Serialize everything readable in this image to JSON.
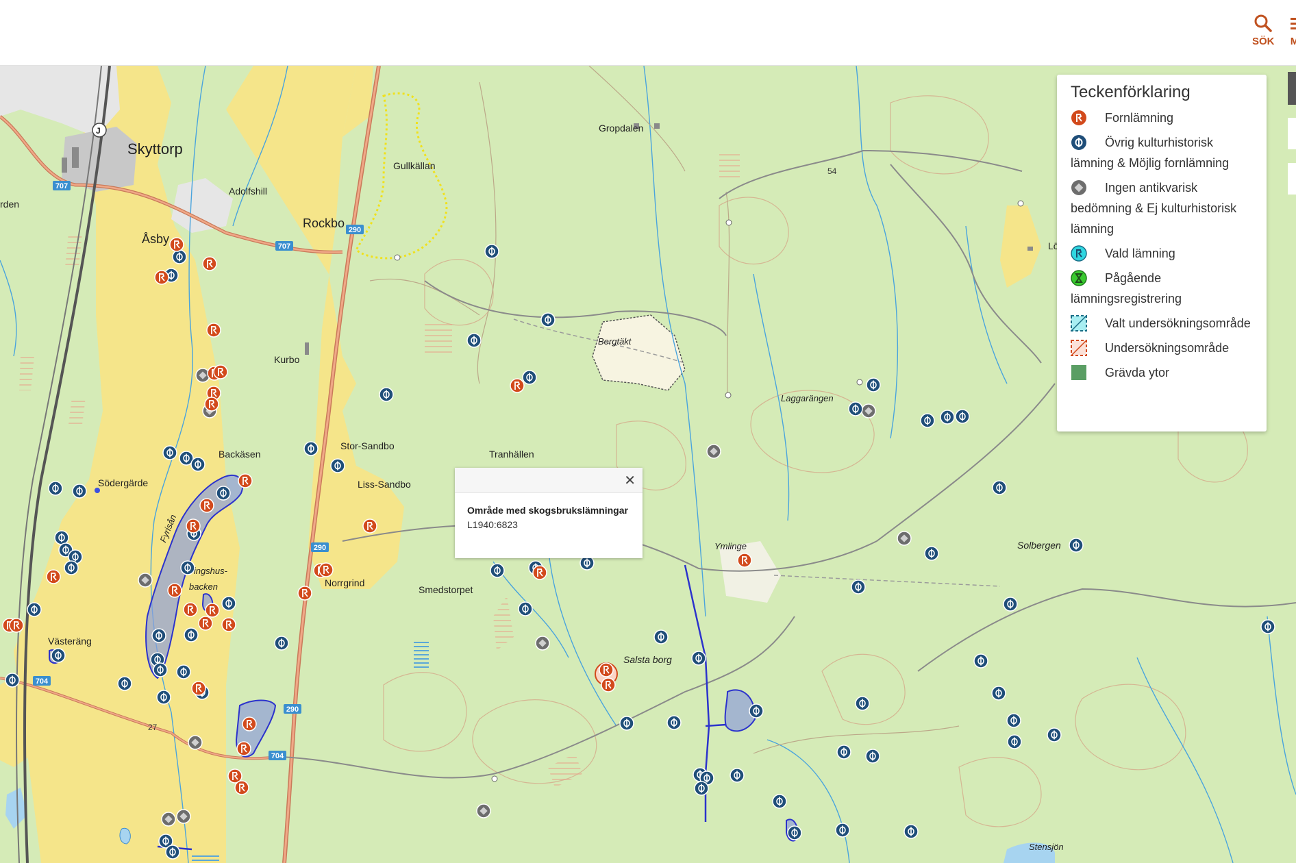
{
  "toolbar": {
    "search_label": "SÖK",
    "menu_label": "M"
  },
  "colors": {
    "accent": "#c0511f",
    "forn": "#d24a1c",
    "ovrig": "#1f4e79",
    "ingen": "#6d6d6d",
    "vald": "#2fd6e0",
    "pagaende": "#39c92f",
    "gravda": "#5a9e64",
    "field": "#f5e58a",
    "forest": "#d5ebb7"
  },
  "legend": {
    "title": "Teckenförklaring",
    "items": [
      {
        "label": "Fornlämning",
        "icon": "fornlamning-icon"
      },
      {
        "label": "Övrig kulturhistorisk lämning & Möjlig fornlämning",
        "icon": "ovrig-lamning-icon"
      },
      {
        "label": "Ingen antikvarisk bedömning & Ej kulturhistorisk lämning",
        "icon": "ingen-bedomning-icon"
      },
      {
        "label": "Vald lämning",
        "icon": "vald-lamning-icon"
      },
      {
        "label": "Pågående lämningsregistrering",
        "icon": "pagaende-icon"
      },
      {
        "label": "Valt undersökningsområde",
        "icon": "valt-omrade-icon"
      },
      {
        "label": "Undersökningsområde",
        "icon": "undersokningsomrade-icon"
      },
      {
        "label": "Grävda ytor",
        "icon": "gravda-ytor-icon"
      }
    ]
  },
  "popup": {
    "title": "Område med skogsbrukslämningar",
    "id": "L1940:6823"
  },
  "places": {
    "skyttorp": "Skyttorp",
    "rden": "rden",
    "adolfshill": "Adolfshill",
    "asby": "Åsby",
    "rockbo": "Rockbo",
    "gullkallan": "Gullkällan",
    "gropdalen": "Gropdalen",
    "bergtakt": "Bergtäkt",
    "kurbo": "Kurbo",
    "stor_sandbo": "Stor-Sandbo",
    "liss_sandbo": "Liss-Sandbo",
    "tranhallen": "Tranhällen",
    "backasen": "Backäsen",
    "sodergarde": "Södergärde",
    "fyrisan": "Fyrisån",
    "tingshus": "Tingshus-",
    "backen": "backen",
    "norrgrind": "Norrgrind",
    "smedstorpet": "Smedstorpet",
    "vasterang": "Västeräng",
    "salsta_borg": "Salsta borg",
    "ymlinge": "Ymlinge",
    "laggarangen": "Laggarängen",
    "lovlajde": "Lövläjde",
    "solbergen": "Solbergen",
    "stensjon": "Stensjön"
  },
  "roads": {
    "r707a": "707",
    "r707b": "707",
    "r290a": "290",
    "r290b": "290",
    "r290c": "290",
    "r704a": "704",
    "r704b": "704",
    "r27": "27",
    "r54": "54"
  },
  "markers": {
    "forn": [
      [
        258,
        357
      ],
      [
        236,
        405
      ],
      [
        306,
        385
      ],
      [
        312,
        482
      ],
      [
        313,
        545
      ],
      [
        312,
        574
      ],
      [
        322,
        543
      ],
      [
        309,
        590
      ],
      [
        358,
        702
      ],
      [
        302,
        738
      ],
      [
        282,
        768
      ],
      [
        255,
        862
      ],
      [
        310,
        891
      ],
      [
        278,
        890
      ],
      [
        300,
        910
      ],
      [
        334,
        912
      ],
      [
        290,
        1005
      ],
      [
        356,
        1093
      ],
      [
        364,
        1057
      ],
      [
        343,
        1133
      ],
      [
        353,
        1150
      ],
      [
        540,
        768
      ],
      [
        468,
        833
      ],
      [
        445,
        866
      ],
      [
        476,
        832
      ],
      [
        755,
        563
      ],
      [
        788,
        836
      ],
      [
        885,
        978
      ],
      [
        888,
        1000
      ],
      [
        1087,
        818
      ],
      [
        14,
        913
      ],
      [
        24,
        913
      ],
      [
        78,
        842
      ]
    ],
    "ovrig": [
      [
        262,
        375
      ],
      [
        250,
        402
      ],
      [
        718,
        367
      ],
      [
        800,
        467
      ],
      [
        692,
        497
      ],
      [
        773,
        551
      ],
      [
        564,
        576
      ],
      [
        454,
        655
      ],
      [
        248,
        661
      ],
      [
        272,
        669
      ],
      [
        289,
        678
      ],
      [
        493,
        680
      ],
      [
        81,
        713
      ],
      [
        116,
        717
      ],
      [
        326,
        720
      ],
      [
        283,
        779
      ],
      [
        90,
        785
      ],
      [
        96,
        803
      ],
      [
        110,
        813
      ],
      [
        104,
        829
      ],
      [
        274,
        829
      ],
      [
        334,
        881
      ],
      [
        232,
        928
      ],
      [
        279,
        927
      ],
      [
        50,
        890
      ],
      [
        85,
        957
      ],
      [
        230,
        963
      ],
      [
        234,
        978
      ],
      [
        268,
        981
      ],
      [
        239,
        1018
      ],
      [
        295,
        1011
      ],
      [
        18,
        993
      ],
      [
        182,
        998
      ],
      [
        411,
        939
      ],
      [
        726,
        833
      ],
      [
        782,
        829
      ],
      [
        857,
        822
      ],
      [
        767,
        889
      ],
      [
        965,
        930
      ],
      [
        1020,
        961
      ],
      [
        915,
        1056
      ],
      [
        984,
        1055
      ],
      [
        1104,
        1038
      ],
      [
        1076,
        1132
      ],
      [
        1022,
        1131
      ],
      [
        1249,
        597
      ],
      [
        1275,
        562
      ],
      [
        1354,
        614
      ],
      [
        1383,
        609
      ],
      [
        1405,
        608
      ],
      [
        1459,
        712
      ],
      [
        1571,
        796
      ],
      [
        1360,
        808
      ],
      [
        1475,
        882
      ],
      [
        1458,
        1012
      ],
      [
        1432,
        965
      ],
      [
        1253,
        857
      ],
      [
        1539,
        1073
      ],
      [
        1259,
        1027
      ],
      [
        1232,
        1098
      ],
      [
        1274,
        1104
      ],
      [
        1481,
        1083
      ],
      [
        1032,
        1136
      ],
      [
        1138,
        1170
      ],
      [
        1024,
        1151
      ],
      [
        1160,
        1216
      ],
      [
        1330,
        1214
      ],
      [
        1230,
        1212
      ],
      [
        1851,
        915
      ],
      [
        1480,
        1052
      ],
      [
        242,
        1228
      ],
      [
        252,
        1244
      ]
    ],
    "ingen": [
      [
        296,
        548
      ],
      [
        306,
        600
      ],
      [
        212,
        847
      ],
      [
        285,
        1084
      ],
      [
        792,
        939
      ],
      [
        1042,
        659
      ],
      [
        1320,
        786
      ],
      [
        1268,
        600
      ],
      [
        706,
        1184
      ],
      [
        246,
        1196
      ],
      [
        268,
        1192
      ]
    ]
  }
}
